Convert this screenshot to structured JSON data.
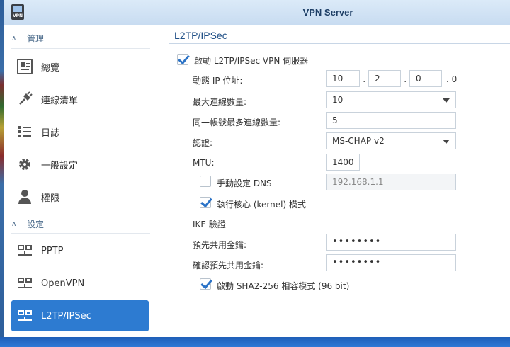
{
  "window": {
    "title": "VPN Server",
    "icon_label": "VPN"
  },
  "sidebar": {
    "groups": [
      {
        "label": "管理"
      },
      {
        "label": "設定"
      }
    ],
    "manage_items": [
      {
        "label": "總覽",
        "icon": "overview-icon"
      },
      {
        "label": "連線清單",
        "icon": "plug-icon"
      },
      {
        "label": "日誌",
        "icon": "log-list-icon"
      },
      {
        "label": "一般設定",
        "icon": "gear-icon"
      },
      {
        "label": "權限",
        "icon": "user-icon"
      }
    ],
    "settings_items": [
      {
        "label": "PPTP",
        "icon": "network-icon"
      },
      {
        "label": "OpenVPN",
        "icon": "network-icon"
      },
      {
        "label": "L2TP/IPSec",
        "icon": "network-icon",
        "selected": true
      }
    ]
  },
  "main": {
    "section_title": "L2TP/IPSec",
    "enable": {
      "label": "啟動 L2TP/IPSec VPN 伺服器",
      "checked": true
    },
    "dynamic_ip": {
      "label": "動態 IP 位址:",
      "octets": [
        "10",
        "2",
        "0"
      ],
      "last": "0"
    },
    "max_connections": {
      "label": "最大連線數量:",
      "value": "10"
    },
    "max_per_account": {
      "label": "同一帳號最多連線數量:",
      "value": "5"
    },
    "auth": {
      "label": "認證:",
      "value": "MS-CHAP v2"
    },
    "mtu": {
      "label": "MTU:",
      "value": "1400"
    },
    "manual_dns": {
      "label": "手動設定 DNS",
      "checked": false,
      "value": "192.168.1.1"
    },
    "kernel_mode": {
      "label": "執行核心 (kernel) 模式",
      "checked": true
    },
    "ike_heading": "IKE 驗證",
    "psk": {
      "label": "預先共用金鑰:",
      "value": "••••••••"
    },
    "psk_confirm": {
      "label": "確認預先共用金鑰:",
      "value": "••••••••"
    },
    "sha2": {
      "label": "啟動 SHA2-256 相容模式 (96 bit)",
      "checked": true
    }
  },
  "colors": {
    "accent": "#2d7bd1",
    "titlebar": "#cfe0f3",
    "section_title": "#1f4f86"
  }
}
